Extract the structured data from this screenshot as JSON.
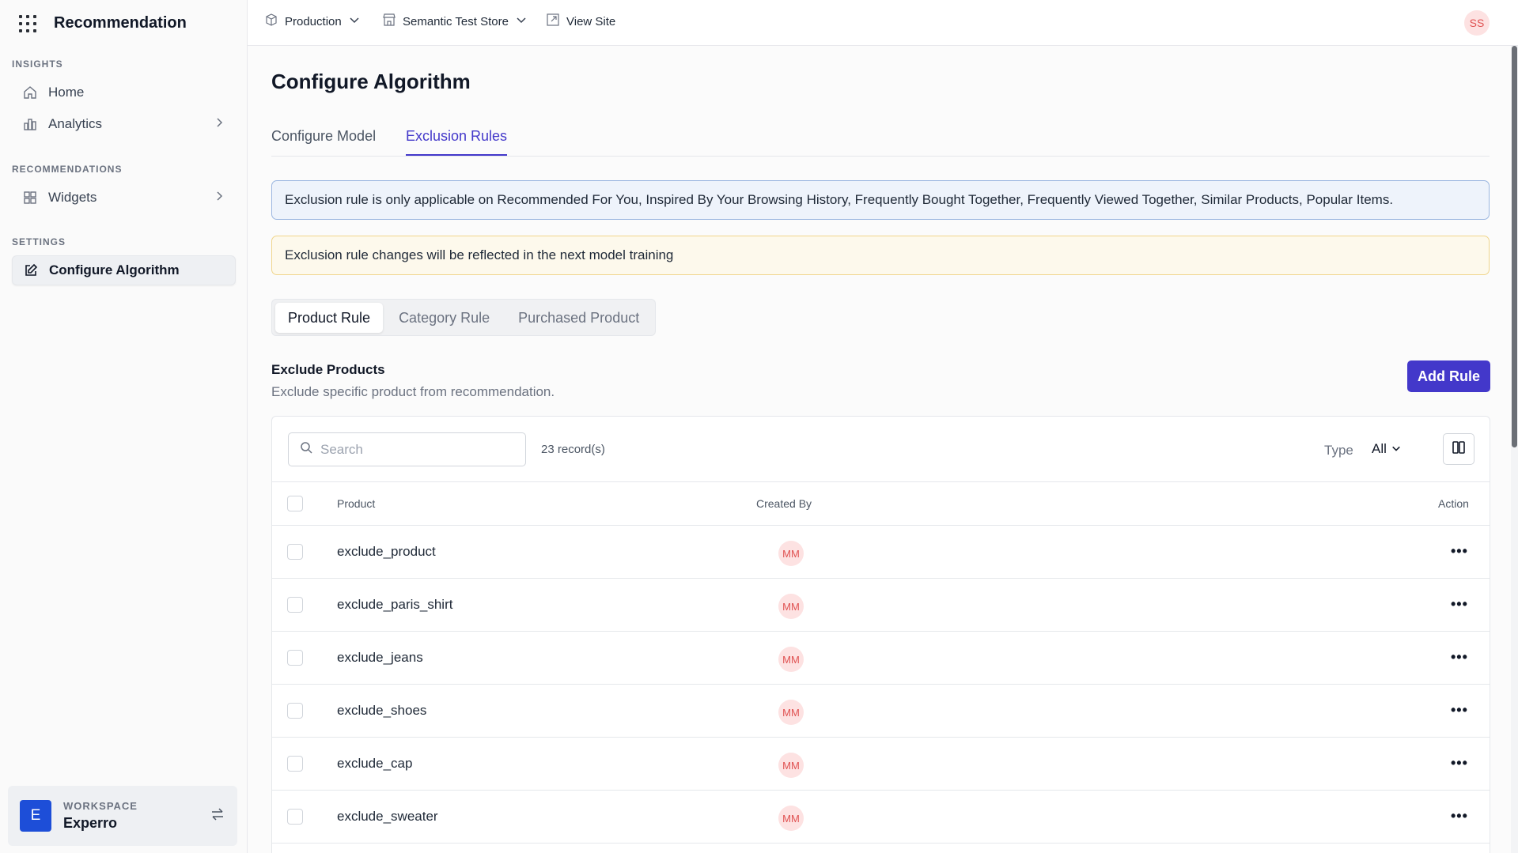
{
  "app": {
    "title": "Recommendation"
  },
  "sidebar": {
    "sections": [
      {
        "label": "INSIGHTS"
      },
      {
        "label": "RECOMMENDATIONS"
      },
      {
        "label": "SETTINGS"
      }
    ],
    "items": [
      {
        "label": "Home",
        "icon": "home-icon"
      },
      {
        "label": "Analytics",
        "icon": "analytics-icon"
      },
      {
        "label": "Widgets",
        "icon": "widgets-icon"
      },
      {
        "label": "Configure Algorithm",
        "icon": "edit-icon",
        "active": true
      }
    ],
    "workspace": {
      "label": "WORKSPACE",
      "name": "Experro",
      "initial": "E"
    }
  },
  "topbar": {
    "environment": "Production",
    "store": "Semantic Test Store",
    "view_site": "View Site",
    "user_initials": "SS"
  },
  "main": {
    "title": "Configure Algorithm",
    "tabs": [
      {
        "label": "Configure Model"
      },
      {
        "label": "Exclusion Rules",
        "active": true
      }
    ],
    "info_alert": "Exclusion rule is only applicable on Recommended For You, Inspired By Your Browsing History, Frequently Bought Together, Frequently Viewed Together, Similar Products, Popular Items.",
    "warn_alert": "Exclusion rule changes will be reflected in the next model training",
    "segments": [
      {
        "label": "Product Rule",
        "active": true
      },
      {
        "label": "Category Rule"
      },
      {
        "label": "Purchased Product"
      }
    ],
    "section_title": "Exclude Products",
    "section_subtitle": "Exclude specific product from recommendation.",
    "add_button": "Add Rule",
    "search_placeholder": "Search",
    "records": "23 record(s)",
    "type_label": "Type",
    "type_value": "All",
    "columns": {
      "product": "Product",
      "created_by": "Created By",
      "action": "Action"
    },
    "rows": [
      {
        "product": "exclude_product",
        "created_by": "MM"
      },
      {
        "product": "exclude_paris_shirt",
        "created_by": "MM"
      },
      {
        "product": "exclude_jeans",
        "created_by": "MM"
      },
      {
        "product": "exclude_shoes",
        "created_by": "MM"
      },
      {
        "product": "exclude_cap",
        "created_by": "MM"
      },
      {
        "product": "exclude_sweater",
        "created_by": "MM"
      }
    ]
  },
  "colors": {
    "accent": "#4338ca",
    "avatar_bg": "#fde2e2",
    "avatar_fg": "#e05252",
    "workspace_badge": "#1d4ed8"
  }
}
